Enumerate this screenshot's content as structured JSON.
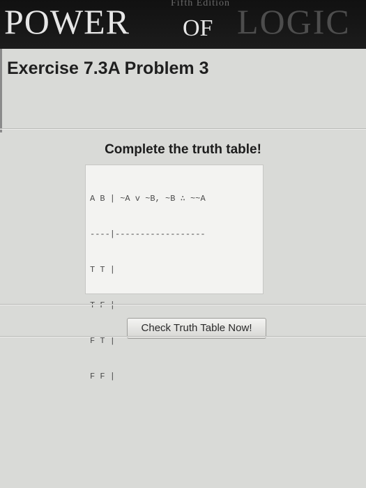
{
  "banner": {
    "edition": "Fifth Edition",
    "title_power": "POWER",
    "title_of": "OF",
    "title_logic": "LOGIC"
  },
  "exercise_title": "Exercise 7.3A Problem 3",
  "instructions": "Complete the truth table!",
  "truth_table": {
    "header": "A B | ~A v ~B, ~B ∴ ~~A",
    "separator": "----|------------------",
    "rows": [
      "T T |",
      "T F |",
      "F T |",
      "F F |"
    ]
  },
  "check_button_label": "Check Truth Table Now!"
}
